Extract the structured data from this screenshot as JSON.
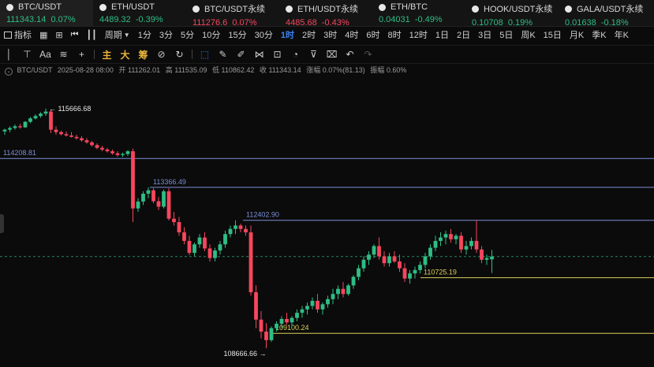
{
  "tickers": [
    {
      "name": "BTC/USDT",
      "price": "111343.14",
      "change": "0.07%",
      "dir": "up",
      "active": true
    },
    {
      "name": "ETH/USDT",
      "price": "4489.32",
      "change": "-0.39%",
      "dir": "up"
    },
    {
      "name": "BTC/USDT永续",
      "price": "111276.6",
      "change": "0.07%",
      "dir": "dn"
    },
    {
      "name": "ETH/USDT永续",
      "price": "4485.68",
      "change": "-0.43%",
      "dir": "dn"
    },
    {
      "name": "ETH/BTC",
      "price": "0.04031",
      "change": "-0.49%",
      "dir": "up"
    },
    {
      "name": "HOOK/USDT永续",
      "price": "0.10708",
      "change": "0.19%",
      "dir": "up"
    },
    {
      "name": "GALA/USDT永续",
      "price": "0.01638",
      "change": "-0.18%",
      "dir": "up"
    }
  ],
  "timeframes": {
    "indicator_label": "指标",
    "period_label": "周期",
    "items": [
      "1分",
      "3分",
      "5分",
      "10分",
      "15分",
      "30分",
      "1时",
      "2时",
      "3时",
      "4时",
      "6时",
      "8时",
      "12时",
      "1日",
      "2日",
      "3日",
      "5日",
      "周K",
      "15日",
      "月K",
      "季K",
      "年K"
    ],
    "selected": "1时"
  },
  "toolbar": {
    "tools": [
      "line-tool",
      "horizontal-line-tool",
      "text-tool",
      "fib-tool",
      "plus-tool"
    ],
    "gold_labels": [
      "主",
      "大",
      "筹"
    ],
    "tools2": [
      "measure-tool",
      "select-tool",
      "pen-tool",
      "brush-tool",
      "pattern-tool",
      "lock-tool",
      "shape-tool",
      "filter-tool",
      "delete-tool",
      "undo-tool",
      "redo-tool"
    ]
  },
  "ohlc": {
    "symbol": "BTC/USDT",
    "time": "2025-08-28 08:00",
    "open_label": "开",
    "open": "111262.01",
    "high_label": "高",
    "high": "111535.09",
    "low_label": "低",
    "low": "110862.42",
    "close_label": "收",
    "close": "111343.14",
    "change_label": "涨幅",
    "change": "0.07%(81.13)",
    "amp_label": "振幅",
    "amp": "0.60%"
  },
  "chart_data": {
    "type": "candlestick",
    "price_range": [
      108300,
      116400
    ],
    "high_marker": "115666.68",
    "low_marker": "108666.66",
    "hlines": [
      {
        "label": "114208.81",
        "value": 114208.81,
        "color": "#7c8fd6"
      },
      {
        "label": "113366.49",
        "value": 113366.49,
        "color": "#7c8fd6"
      },
      {
        "label": "112402.90",
        "value": 112402.9,
        "color": "#7c8fd6"
      },
      {
        "label": "110725.19",
        "value": 110725.19,
        "color": "#d9d05a"
      },
      {
        "label": "109100.24",
        "value": 109100.24,
        "color": "#d9d05a"
      }
    ],
    "current_price": 111343.14,
    "candles": [
      [
        115000,
        115080,
        114900,
        115050
      ],
      [
        115050,
        115150,
        114980,
        115100
      ],
      [
        115100,
        115200,
        115050,
        115150
      ],
      [
        115150,
        115220,
        115080,
        115120
      ],
      [
        115120,
        115300,
        115100,
        115280
      ],
      [
        115280,
        115420,
        115240,
        115380
      ],
      [
        115380,
        115500,
        115350,
        115450
      ],
      [
        115450,
        115560,
        115400,
        115520
      ],
      [
        115520,
        115666.68,
        115450,
        115580
      ],
      [
        115580,
        115620,
        114950,
        115050
      ],
      [
        115050,
        115150,
        114900,
        114980
      ],
      [
        114980,
        115020,
        114880,
        114920
      ],
      [
        114920,
        115000,
        114850,
        114880
      ],
      [
        114880,
        114980,
        114820,
        114840
      ],
      [
        114840,
        114900,
        114760,
        114800
      ],
      [
        114800,
        114860,
        114700,
        114740
      ],
      [
        114740,
        114800,
        114640,
        114680
      ],
      [
        114680,
        114720,
        114560,
        114600
      ],
      [
        114600,
        114650,
        114480,
        114520
      ],
      [
        114520,
        114580,
        114420,
        114470
      ],
      [
        114470,
        114520,
        114380,
        114420
      ],
      [
        114420,
        114470,
        114320,
        114360
      ],
      [
        114360,
        114420,
        114260,
        114310
      ],
      [
        114310,
        114380,
        114250,
        114340
      ],
      [
        114340,
        114450,
        114280,
        114420
      ],
      [
        114420,
        114500,
        112350,
        112750
      ],
      [
        112750,
        113050,
        112650,
        112950
      ],
      [
        112950,
        113250,
        112850,
        113180
      ],
      [
        113180,
        113366.49,
        113050,
        113280
      ],
      [
        113280,
        113340,
        112900,
        112960
      ],
      [
        112960,
        113080,
        112700,
        112800
      ],
      [
        112800,
        113300,
        112750,
        113250
      ],
      [
        113250,
        113340,
        112400,
        112450
      ],
      [
        112450,
        112650,
        112250,
        112350
      ],
      [
        112350,
        112500,
        111950,
        112050
      ],
      [
        112050,
        112200,
        111700,
        111800
      ],
      [
        111800,
        111950,
        111380,
        111450
      ],
      [
        111450,
        111750,
        111350,
        111700
      ],
      [
        111700,
        112000,
        111600,
        111900
      ],
      [
        111900,
        112050,
        111500,
        111580
      ],
      [
        111580,
        111700,
        111200,
        111300
      ],
      [
        111300,
        111600,
        111200,
        111520
      ],
      [
        111520,
        111800,
        111400,
        111700
      ],
      [
        111700,
        112100,
        111600,
        112000
      ],
      [
        112000,
        112250,
        111900,
        112150
      ],
      [
        112150,
        112402.9,
        112000,
        112250
      ],
      [
        112250,
        112300,
        112050,
        112150
      ],
      [
        112150,
        112250,
        111950,
        112050
      ],
      [
        112050,
        112250,
        110200,
        110300
      ],
      [
        110300,
        110500,
        109250,
        109500
      ],
      [
        109500,
        109750,
        108950,
        109150
      ],
      [
        109150,
        109400,
        108666.66,
        108900
      ],
      [
        108900,
        109300,
        108850,
        109250
      ],
      [
        109250,
        109450,
        109150,
        109380
      ],
      [
        109380,
        109600,
        109250,
        109520
      ],
      [
        109520,
        109700,
        109350,
        109420
      ],
      [
        109420,
        109600,
        109300,
        109550
      ],
      [
        109550,
        109800,
        109450,
        109700
      ],
      [
        109700,
        109900,
        109550,
        109800
      ],
      [
        109800,
        110000,
        109650,
        109900
      ],
      [
        109900,
        110150,
        109800,
        110050
      ],
      [
        110050,
        110250,
        109700,
        109800
      ],
      [
        109800,
        110000,
        109650,
        109950
      ],
      [
        109950,
        110200,
        109850,
        110100
      ],
      [
        110100,
        110400,
        109950,
        110250
      ],
      [
        110250,
        110500,
        110100,
        110400
      ],
      [
        110400,
        110600,
        110150,
        110250
      ],
      [
        110250,
        110550,
        110200,
        110500
      ],
      [
        110500,
        110800,
        110400,
        110750
      ],
      [
        110750,
        111100,
        110650,
        111000
      ],
      [
        111000,
        111350,
        110900,
        111250
      ],
      [
        111250,
        111500,
        111100,
        111400
      ],
      [
        111400,
        111700,
        111300,
        111650
      ],
      [
        111650,
        111900,
        111250,
        111350
      ],
      [
        111350,
        111500,
        111050,
        111150
      ],
      [
        111150,
        111450,
        111050,
        111350
      ],
      [
        111350,
        111500,
        111150,
        111200
      ],
      [
        111200,
        111400,
        110900,
        111000
      ],
      [
        111000,
        111150,
        110600,
        110700
      ],
      [
        110700,
        110950,
        110550,
        110850
      ],
      [
        110850,
        111050,
        110700,
        110950
      ],
      [
        110950,
        111200,
        110850,
        111100
      ],
      [
        111100,
        111450,
        111000,
        111350
      ],
      [
        111350,
        111700,
        111250,
        111600
      ],
      [
        111600,
        111950,
        111500,
        111800
      ],
      [
        111800,
        112050,
        111650,
        111900
      ],
      [
        111900,
        112100,
        111700,
        112000
      ],
      [
        112000,
        112150,
        111750,
        111850
      ],
      [
        111850,
        112000,
        111700,
        111950
      ],
      [
        111950,
        112050,
        111450,
        111550
      ],
      [
        111550,
        111800,
        111400,
        111650
      ],
      [
        111650,
        111900,
        111550,
        111800
      ],
      [
        111800,
        112402.9,
        111450,
        111550
      ],
      [
        111550,
        111650,
        111150,
        111250
      ],
      [
        111250,
        111400,
        111100,
        111300
      ],
      [
        111262.01,
        111535.09,
        110862.42,
        111343.14
      ]
    ]
  }
}
